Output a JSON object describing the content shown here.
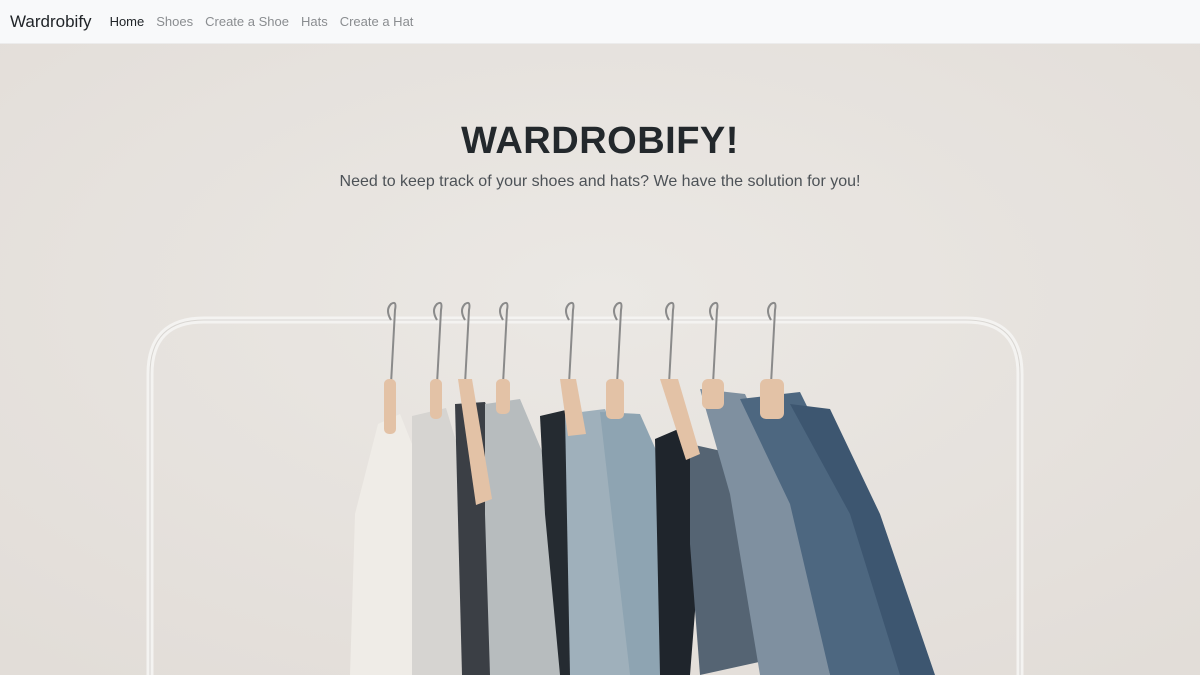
{
  "navbar": {
    "brand": "Wardrobify",
    "links": [
      {
        "label": "Home",
        "active": true
      },
      {
        "label": "Shoes",
        "active": false
      },
      {
        "label": "Create a Shoe",
        "active": false
      },
      {
        "label": "Hats",
        "active": false
      },
      {
        "label": "Create a Hat",
        "active": false
      }
    ]
  },
  "hero": {
    "title": "WARDROBIFY!",
    "subtitle": "Need to keep track of your shoes and hats? We have the solution for you!",
    "image_description_icon": "clothes-rack-photo"
  },
  "colors": {
    "navbar_bg": "#f8f9fa",
    "hero_bg": "#e9e5e1",
    "title": "#23282c",
    "active_link": "#212529",
    "inactive_link": "#8a8d90"
  }
}
